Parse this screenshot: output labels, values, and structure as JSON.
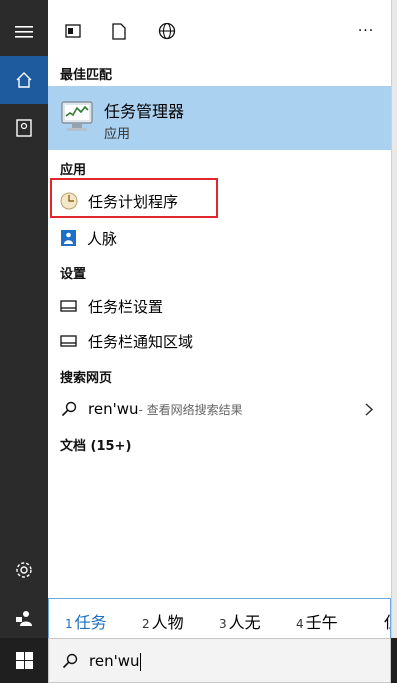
{
  "toolbar": {
    "more_label": "···"
  },
  "sections": {
    "best_match": "最佳匹配",
    "apps": "应用",
    "settings": "设置",
    "web": "搜索网页",
    "documents": "文档 (15+)"
  },
  "best_match": {
    "title": "任务管理器",
    "subtitle": "应用"
  },
  "apps": [
    {
      "label": "任务计划程序",
      "icon": "task-scheduler-icon"
    },
    {
      "label": "人脉",
      "icon": "people-icon"
    }
  ],
  "settings": [
    {
      "label": "任务栏设置",
      "icon": "taskbar-icon"
    },
    {
      "label": "任务栏通知区域",
      "icon": "taskbar-icon"
    }
  ],
  "web": {
    "query": "ren'wu",
    "suffix": " - 查看网络搜索结果"
  },
  "ime": {
    "candidates": [
      {
        "num": "1",
        "text": "任务"
      },
      {
        "num": "2",
        "text": "人物"
      },
      {
        "num": "3",
        "text": "人无"
      },
      {
        "num": "4",
        "text": "壬午"
      },
      {
        "num": "",
        "text": "仨"
      }
    ]
  },
  "search": {
    "value": "ren'wu"
  },
  "colors": {
    "accent": "#1e5a9e",
    "highlight": "#aad1ef",
    "annotation": "#e3262b",
    "ime_selected": "#1b6ec2"
  }
}
